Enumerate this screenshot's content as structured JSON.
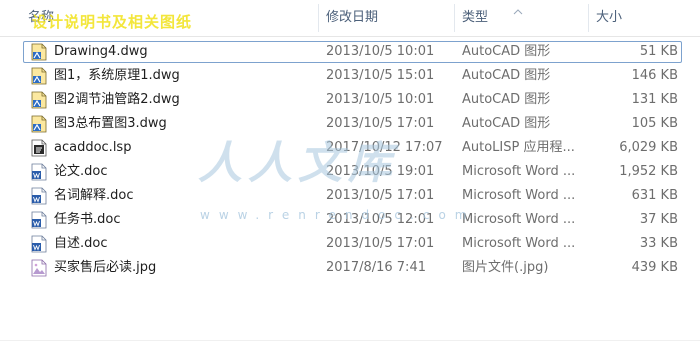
{
  "header": {
    "name_label": "名称",
    "date_label": "修改日期",
    "type_label": "类型",
    "size_label": "大小",
    "overlay_text": "设计说明书及相关图纸"
  },
  "files": [
    {
      "name": "Drawing4.dwg",
      "date": "2013/10/5 10:01",
      "type": "AutoCAD 图形",
      "size": "51 KB",
      "icon": "dwg-icon",
      "selected": true
    },
    {
      "name": "图1，系统原理1.dwg",
      "date": "2013/10/5 15:01",
      "type": "AutoCAD 图形",
      "size": "146 KB",
      "icon": "dwg-icon"
    },
    {
      "name": "图2调节油管路2.dwg",
      "date": "2013/10/5 10:01",
      "type": "AutoCAD 图形",
      "size": "131 KB",
      "icon": "dwg-icon"
    },
    {
      "name": "图3总布置图3.dwg",
      "date": "2013/10/5 17:01",
      "type": "AutoCAD 图形",
      "size": "105 KB",
      "icon": "dwg-icon"
    },
    {
      "name": "acaddoc.lsp",
      "date": "2017/10/12 17:07",
      "type": "AutoLISP 应用程...",
      "size": "6,029 KB",
      "icon": "lsp-icon"
    },
    {
      "name": "论文.doc",
      "date": "2013/10/5 19:01",
      "type": "Microsoft Word ...",
      "size": "1,952 KB",
      "icon": "doc-icon"
    },
    {
      "name": "名词解释.doc",
      "date": "2013/10/5 17:01",
      "type": "Microsoft Word ...",
      "size": "631 KB",
      "icon": "doc-icon"
    },
    {
      "name": "任务书.doc",
      "date": "2013/10/5 12:01",
      "type": "Microsoft Word ...",
      "size": "37 KB",
      "icon": "doc-icon"
    },
    {
      "name": "自述.doc",
      "date": "2013/10/5 17:01",
      "type": "Microsoft Word ...",
      "size": "33 KB",
      "icon": "doc-icon"
    },
    {
      "name": "买家售后必读.jpg",
      "date": "2017/8/16 7:41",
      "type": "图片文件(.jpg)",
      "size": "439 KB",
      "icon": "jpg-icon"
    }
  ],
  "watermark": {
    "big_text": "人人文库",
    "url_text": "www.renrendoc.com"
  },
  "colors": {
    "header_text": "#4c607a",
    "selection_border": "#7da2ce",
    "secondary_text": "#6d6d6d",
    "watermark": "#a9c8df"
  }
}
